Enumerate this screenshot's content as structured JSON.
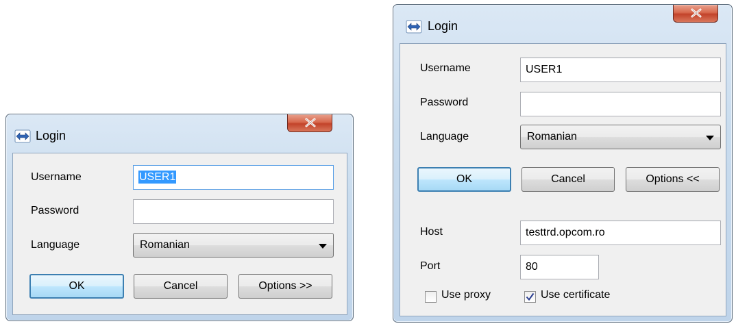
{
  "collapsed": {
    "title": "Login",
    "close_label": "X",
    "username_label": "Username",
    "username_value": "USER1",
    "password_label": "Password",
    "password_value": "",
    "language_label": "Language",
    "language_value": "Romanian",
    "ok_label": "OK",
    "cancel_label": "Cancel",
    "options_label": "Options >>"
  },
  "expanded": {
    "title": "Login",
    "close_label": "X",
    "username_label": "Username",
    "username_value": "USER1",
    "password_label": "Password",
    "password_value": "",
    "language_label": "Language",
    "language_value": "Romanian",
    "ok_label": "OK",
    "cancel_label": "Cancel",
    "options_label": "Options <<",
    "host_label": "Host",
    "host_value": "testtrd.opcom.ro",
    "port_label": "Port",
    "port_value": "80",
    "use_proxy_label": "Use proxy",
    "use_proxy_checked": false,
    "use_certificate_label": "Use certificate",
    "use_certificate_checked": true
  },
  "colors": {
    "frame_top": "#dbe8f5",
    "frame_bottom": "#bfd4ea",
    "client_bg": "#f0f0f0",
    "close_button": "#c2432a",
    "focus_border": "#569de5",
    "selection": "#3399ff"
  },
  "icons": {
    "app": "bidirectional-arrow-icon",
    "close": "close-icon",
    "combo": "chevron-down-icon",
    "check": "checkmark-icon"
  }
}
